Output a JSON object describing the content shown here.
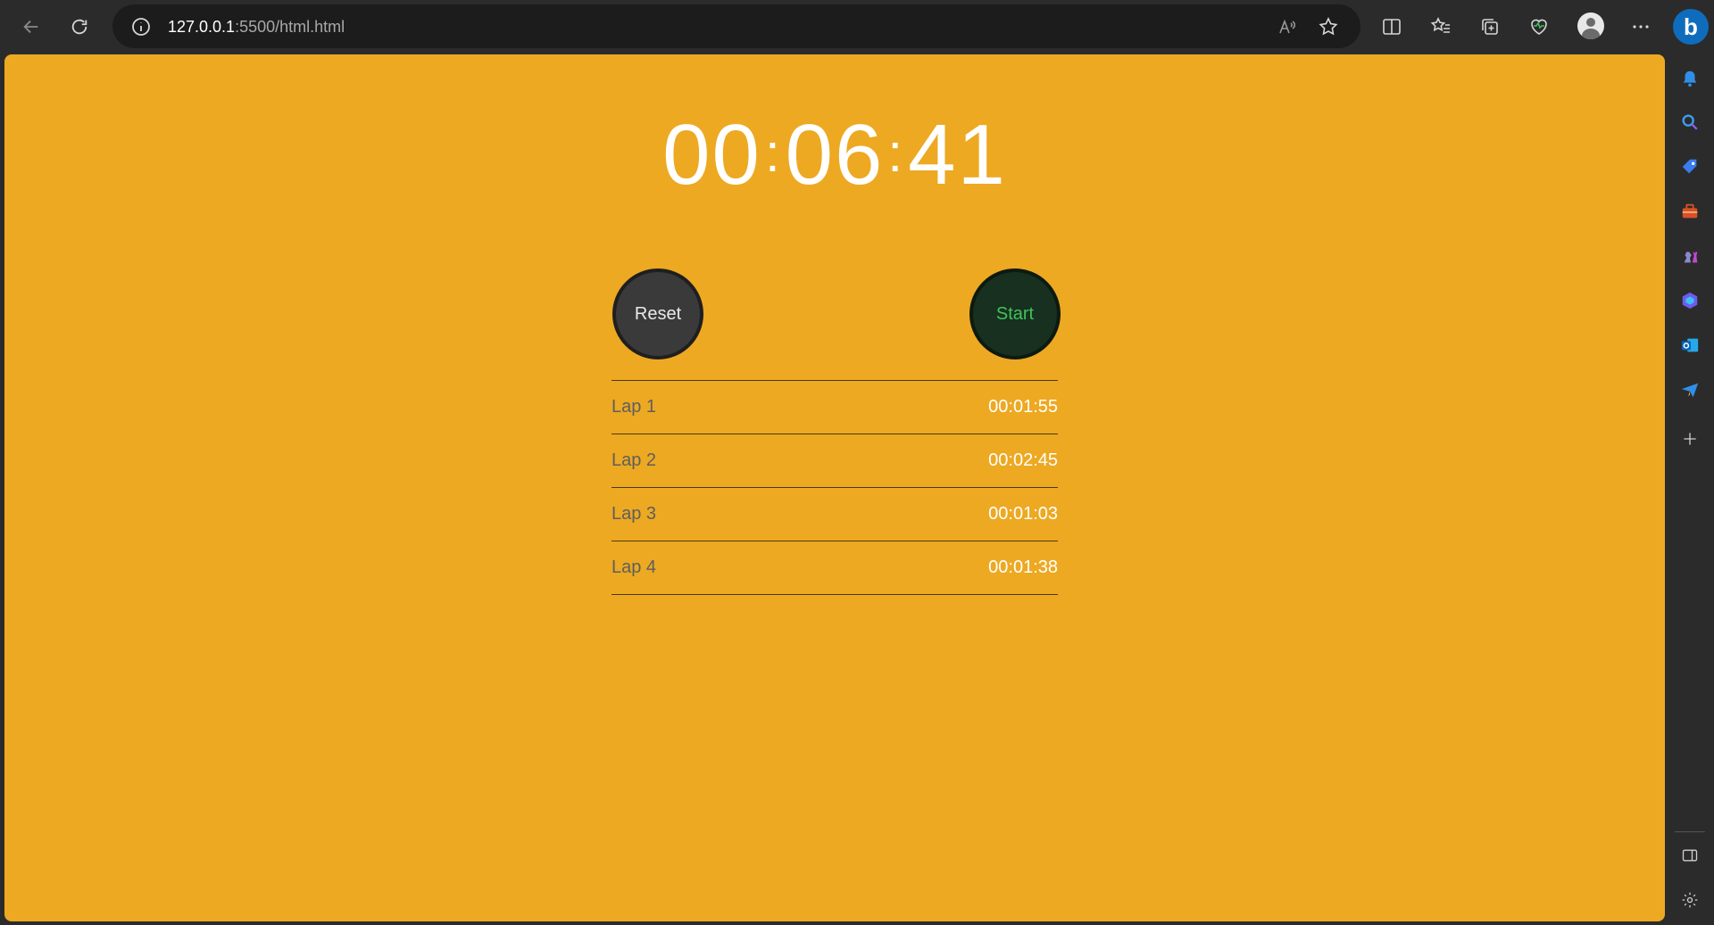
{
  "browser": {
    "url_host": "127.0.0.1",
    "url_rest": ":5500/html.html"
  },
  "stopwatch": {
    "minutes": "00",
    "seconds": "06",
    "centis": "41",
    "separator": ":",
    "reset_label": "Reset",
    "start_label": "Start"
  },
  "laps": [
    {
      "name": "Lap 1",
      "time": "00:01:55"
    },
    {
      "name": "Lap 2",
      "time": "00:02:45"
    },
    {
      "name": "Lap 3",
      "time": "00:01:03"
    },
    {
      "name": "Lap 4",
      "time": "00:01:38"
    }
  ],
  "colors": {
    "page_background": "#eda922",
    "browser_chrome": "#2b2b2b",
    "reset_button": "#3a3a3a",
    "start_button": "#17301f",
    "start_text": "#41c25a"
  }
}
